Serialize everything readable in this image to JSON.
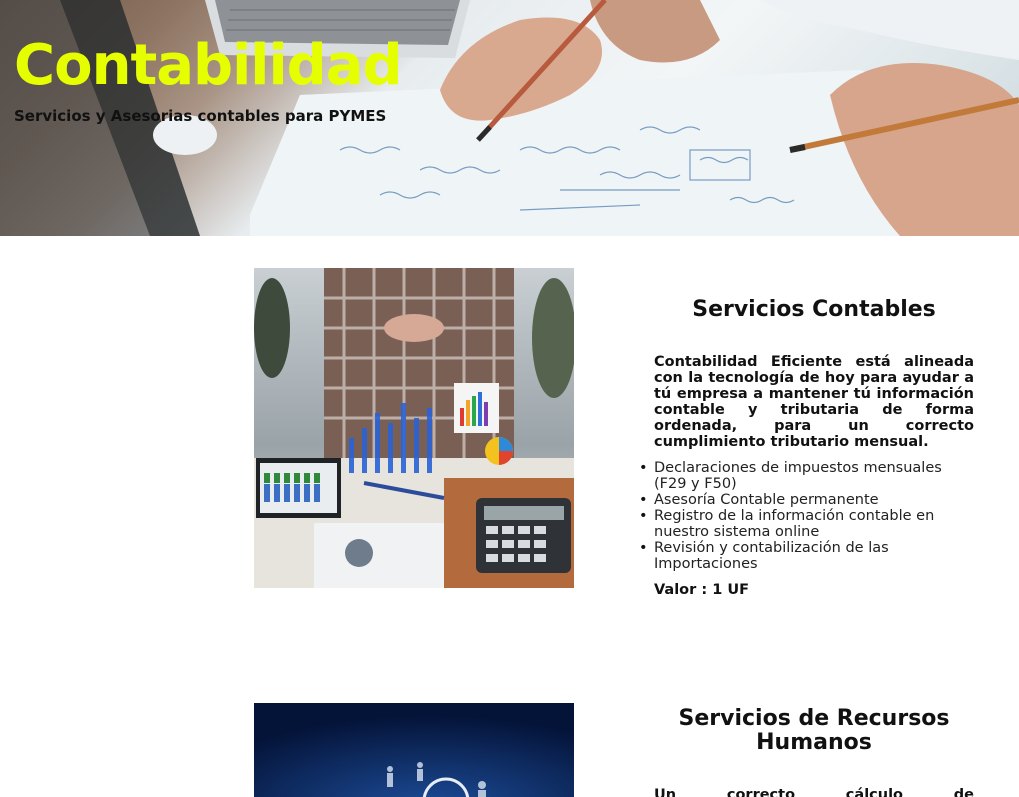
{
  "hero": {
    "title": "Contabilidad",
    "subtitle": "Servicios y Asesorias contables para PYMES",
    "title_color": "#e6ff00"
  },
  "services": [
    {
      "title": "Servicios Contables",
      "description": "Contabilidad Eficiente está alineada con la tecnología de hoy para ayudar a tú empresa a mantener tú información contable y tributaria de forma ordenada, para un correcto cumplimiento tributario mensual.",
      "items": [
        "Declaraciones de impuestos mensuales (F29 y F50)",
        "Asesoría Contable permanente",
        "Registro de la información contable en nuestro sistema online",
        "Revisión y contabilización de las Importaciones"
      ],
      "price": "Valor : 1 UF",
      "image": "accounting-charts-photo"
    },
    {
      "title": "Servicios de Recursos Humanos",
      "description": "Un correcto cálculo de las",
      "image": "human-resources-network-photo"
    }
  ],
  "colors": {
    "accent": "#e6ff00",
    "text": "#111111",
    "background": "#ffffff",
    "hr_image_bg": "#061a45"
  }
}
